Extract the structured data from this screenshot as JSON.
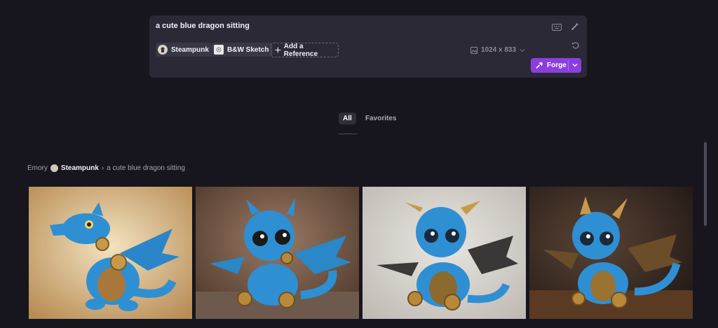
{
  "prompt": {
    "text": "a cute blue dragon sitting",
    "chips": [
      {
        "label": "Steampunk",
        "icon": "steampunk-thumb"
      },
      {
        "label": "B&W Sketch",
        "icon": "sketch-thumb"
      }
    ],
    "add_reference_label": "Add a Reference",
    "dimensions": "1024 x 833",
    "forge_label": "Forge"
  },
  "tabs": [
    {
      "label": "All",
      "active": true
    },
    {
      "label": "Favorites",
      "active": false
    }
  ],
  "breadcrumb": {
    "user": "Emory",
    "style": "Steampunk",
    "separator": "›",
    "prompt": "a cute blue dragon sitting"
  },
  "gallery": {
    "images": [
      {
        "name": "dragon-image-1",
        "background": "parchment"
      },
      {
        "name": "dragon-image-2",
        "background": "studio-brown"
      },
      {
        "name": "dragon-image-3",
        "background": "studio-grey"
      },
      {
        "name": "dragon-image-4",
        "background": "wood-table"
      }
    ]
  },
  "colors": {
    "page_bg": "#17161e",
    "panel_bg": "#2a2935",
    "accent": "#8b3ee0",
    "dragon_blue": "#2f8fd3",
    "brass": "#b8893a"
  }
}
